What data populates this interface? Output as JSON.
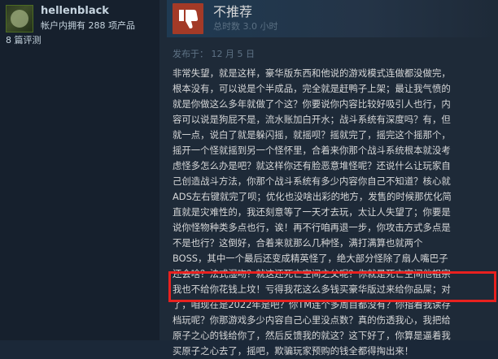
{
  "reviewer": {
    "name": "hellenblack",
    "products_owned": "帐户内拥有 288 项产品",
    "review_count": "8 篇评测"
  },
  "review": {
    "verdict": "不推荐",
    "playtime": "总时数 3.0 小时",
    "posted": "发布于：  12 月 5 日",
    "verdict_icon": "thumbs-down-icon",
    "verdict_color": "#a33a27",
    "highlight_color": "#e8211f",
    "lines": [
      "非常失望，就是这样，豪华版东西和他说的游戏模式连做都没做完，",
      "根本没有，可以说是个半成品，完全就是赶鸭子上架；最让我气愤的",
      "就是你做这么多年就做了个这？你要说你内容比较好吸引人也行，内",
      "容可以说是狗屁不是，流水账加白开水；战斗系统有深度吗？有，但",
      "就一点，说白了就是躲闪摇，就摇呗？摇就完了，摇完这个摇那个，",
      "摇开一个怪就摇到另一个怪怀里，合着来你那个战斗系统根本就没考",
      "虑怪多怎么办是吧？就这样你还有脸恶意堆怪呢？还说什么让玩家自",
      "己创造战斗方法，你那个战斗系统有多少内容你自己不知道？核心就",
      "ADS左右键就完了呗；优化也没啥出彩的地方，发售的时候那优化简",
      "直就是灾难性的，我还刻意等了一天才去玩，太让人失望了；你要是",
      "说你怪物种类多点也行，诶！再不行咱再退一步，你攻击方式多点是",
      "不是也行？这倒好，合着来就那么几种怪，满打满算也就两个",
      "BOSS，其中一个最后还变成精英怪了，绝大部分怪除了扇人嘴巴子",
      "还会啥？法式湿吻？就这还死亡空间之父呢？你就是死亡空间他祖宗",
      "我也不给你花钱上坟！亏得我花这么多钱买豪华版过来给你品屎；对",
      "了，咱现在是2022年是吧？你TM连个多周目都没有？你指着我读存",
      "档玩呢？你那游戏多少内容自己心里没点数？真的伤透我心，我把给",
      "原子之心的钱给你了，然后反馈我的就这？这下好了，你算是逼着我",
      "买原子之心去了，摇吧，欺骗玩家预购的钱全都得掏出来！"
    ]
  }
}
